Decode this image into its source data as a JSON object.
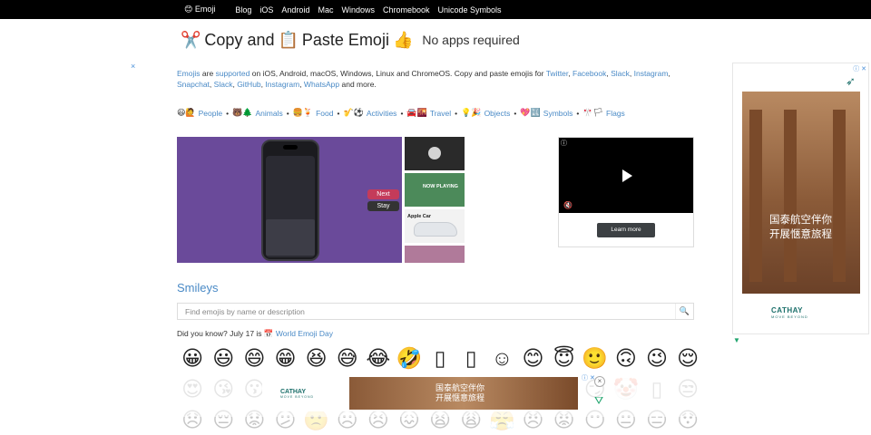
{
  "nav": {
    "brand": "😊 Emoji",
    "items": [
      "Blog",
      "iOS",
      "Android",
      "Mac",
      "Windows",
      "Chromebook",
      "Unicode Symbols"
    ]
  },
  "header": {
    "icon_scissors": "✂️",
    "copy_and": "Copy and",
    "icon_clipboard": "📋",
    "paste_emoji": "Paste Emoji",
    "icon_thumb": "👍",
    "tagline": "No apps required"
  },
  "intro": {
    "emojis_link": "Emojis",
    "are": "are",
    "supported_link": "supported",
    "text1": "on iOS, Android, macOS, Windows, Linux and ChromeOS. Copy and paste emojis for",
    "links": [
      "Twitter",
      "Facebook",
      "Slack",
      "Instagram",
      "Snapchat",
      "Slack",
      "GitHub",
      "Instagram",
      "WhatsApp"
    ],
    "text_end": "and more."
  },
  "categories": [
    {
      "icons": "😃🙋",
      "label": "People"
    },
    {
      "icons": "🐻🌲",
      "label": "Animals"
    },
    {
      "icons": "🍔🍹",
      "label": "Food"
    },
    {
      "icons": "🎷⚽",
      "label": "Activities"
    },
    {
      "icons": "🚘🌇",
      "label": "Travel"
    },
    {
      "icons": "💡🎉",
      "label": "Objects"
    },
    {
      "icons": "💖🔣",
      "label": "Symbols"
    },
    {
      "icons": "🎌🏳",
      "label": "Flags"
    }
  ],
  "video": {
    "next_label": "Next",
    "stay_label": "Stay",
    "now_playing": "NOW PLAYING",
    "apple_car": "Apple Car"
  },
  "ad_box": {
    "learn_more": "Learn more",
    "info": "ⓘ",
    "mute": "🔇"
  },
  "smileys": {
    "heading": "Smileys",
    "search_placeholder": "Find emojis by name or description",
    "search_icon": "🔍",
    "did_you_know": "Did you know? July 17 is",
    "calendar_icon": "📅",
    "world_emoji_day": "World Emoji Day",
    "row1": [
      "😀",
      "😃",
      "😄",
      "😁",
      "😆",
      "😅",
      "😂",
      "🤣",
      "▯",
      "▯",
      "☺",
      "😊",
      "😇",
      "🙂",
      "🙃",
      "😉",
      "😌"
    ],
    "row2": [
      "😍",
      "😘",
      "😗",
      "😙",
      "😚",
      "😋",
      "😜",
      "😝",
      "😛",
      "🤑",
      "🤗",
      "🤓",
      "😎",
      "😏",
      "🤡",
      "▯",
      "😒"
    ],
    "row3": [
      "😞",
      "😔",
      "😟",
      "😕",
      "🙁",
      "☹",
      "😣",
      "😖",
      "😫",
      "😩",
      "😤",
      "😠",
      "😡",
      "😶",
      "😐",
      "😑",
      "😯"
    ]
  },
  "side_ad": {
    "text1": "国泰航空伴你",
    "text2": "开展惬意旅程",
    "brand": "CATHAY",
    "tagline": "MOVE BEYOND",
    "icons": "ⓘ ✕"
  },
  "bottom_ad": {
    "brand": "CATHAY",
    "tagline": "MOVE BEYOND",
    "text1": "国泰航空伴你",
    "text2": "开展惬意旅程",
    "close": "×",
    "x_mark": "ⓘ ✕"
  },
  "misc": {
    "close_x": "×",
    "flag": "▼"
  }
}
